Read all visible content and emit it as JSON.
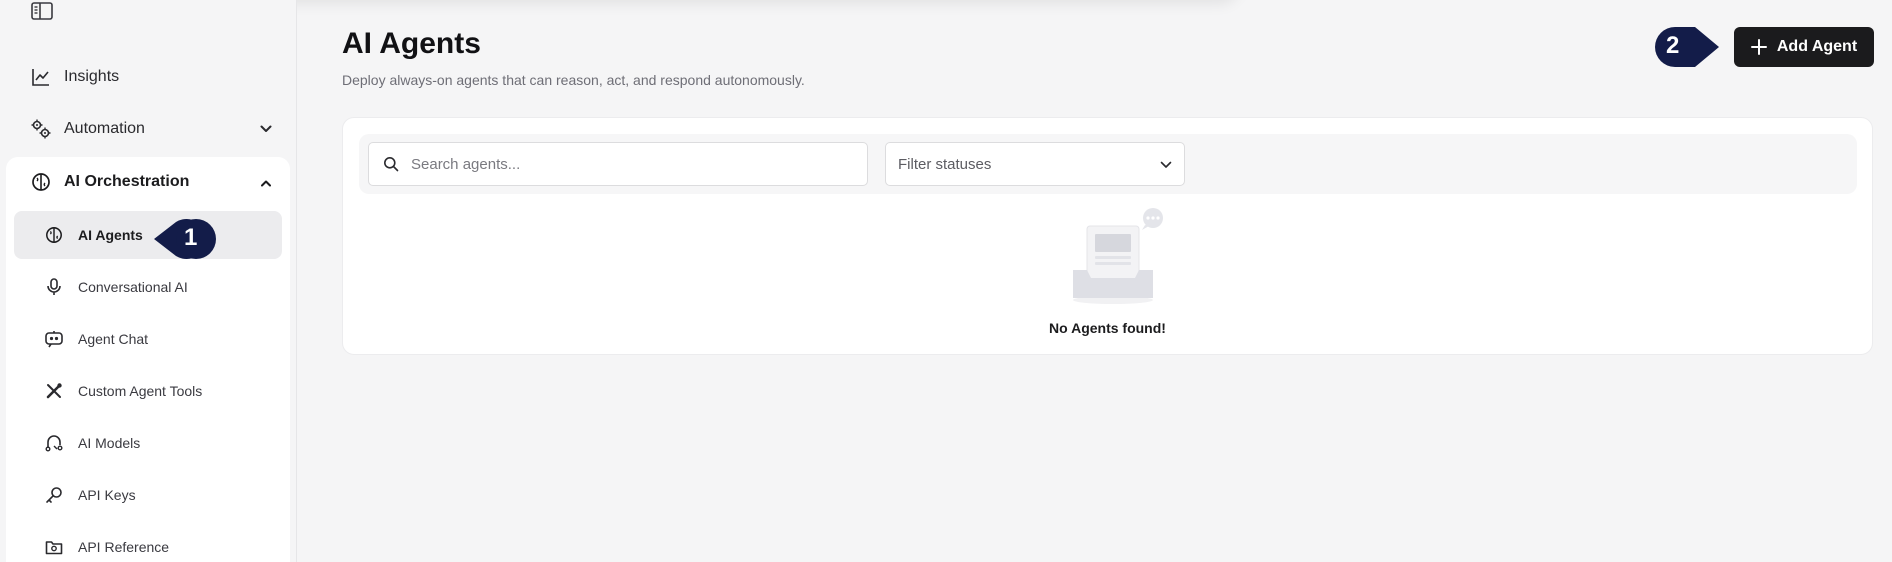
{
  "sidebar": {
    "insights_label": "Insights",
    "automation_label": "Automation",
    "orchestration": {
      "label": "AI Orchestration",
      "items": [
        {
          "label": "AI Agents",
          "icon": "brain-icon",
          "active": true
        },
        {
          "label": "Conversational AI",
          "icon": "microphone-icon"
        },
        {
          "label": "Agent Chat",
          "icon": "robot-chat-icon"
        },
        {
          "label": "Custom Agent Tools",
          "icon": "tools-icon"
        },
        {
          "label": "AI Models",
          "icon": "ai-model-icon"
        },
        {
          "label": "API Keys",
          "icon": "key-icon"
        },
        {
          "label": "API Reference",
          "icon": "api-reference-icon"
        }
      ]
    }
  },
  "callouts": {
    "first": "1",
    "second": "2"
  },
  "main": {
    "title": "AI Agents",
    "subtitle": "Deploy always-on agents that can reason, act, and respond autonomously.",
    "add_button_label": "Add Agent",
    "search_placeholder": "Search agents...",
    "status_filter_placeholder": "Filter statuses",
    "empty_message": "No Agents found!"
  },
  "colors": {
    "callout_navy": "#131c49",
    "button_dark": "#1b1b1d",
    "background": "#f5f5f6"
  }
}
